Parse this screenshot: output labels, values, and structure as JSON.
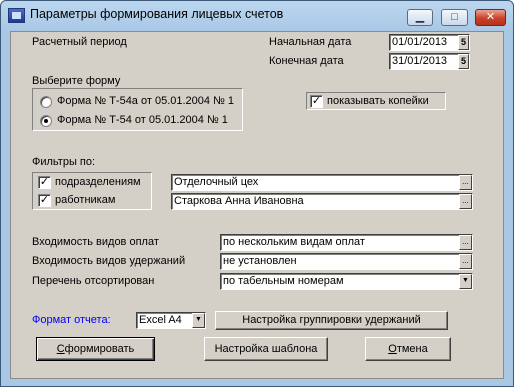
{
  "window": {
    "title": "Параметры формирования лицевых счетов",
    "minimize": "▁",
    "maximize": "□",
    "close": "✕"
  },
  "period": {
    "label": "Расчетный период",
    "start_label": "Начальная дата",
    "start_value": "01/01/2013",
    "end_label": "Конечная  дата",
    "end_value": "31/01/2013",
    "spin_glyph": "5"
  },
  "form": {
    "label": "Выберите форму",
    "options": [
      {
        "label": "Форма № Т-54а от 05.01.2004 № 1",
        "selected": false
      },
      {
        "label": "Форма № Т-54  от 05.01.2004 № 1",
        "selected": true
      }
    ],
    "show_kopecks_label": "показывать копейки",
    "show_kopecks_checked": true
  },
  "filters": {
    "label": "Фильтры по:",
    "departments_label": "подразделениям",
    "departments_checked": true,
    "departments_value": "Отделочный цех",
    "employees_label": "работникам",
    "employees_checked": true,
    "employees_value": "Старкова Анна Ивановна",
    "ellipsis": "..."
  },
  "params": {
    "payments_label": "Входимость видов оплат",
    "payments_value": "по нескольким видам оплат",
    "deductions_label": "Входимость видов удержаний",
    "deductions_value": "не установлен",
    "sort_label": "Перечень отсортирован",
    "sort_value": "по табельным номерам"
  },
  "report": {
    "format_label": "Формат отчета:",
    "format_value": "Excel A4",
    "grouping_button": "Настройка группировки удержаний"
  },
  "actions": {
    "generate_prefix": "",
    "generate_accel": "С",
    "generate_rest": "формировать",
    "template_button": "Настройка шаблона",
    "cancel_prefix": "",
    "cancel_accel": "О",
    "cancel_rest": "тмена"
  },
  "colors": {
    "format_label": "#0000ff",
    "checkmark": "#000000"
  }
}
